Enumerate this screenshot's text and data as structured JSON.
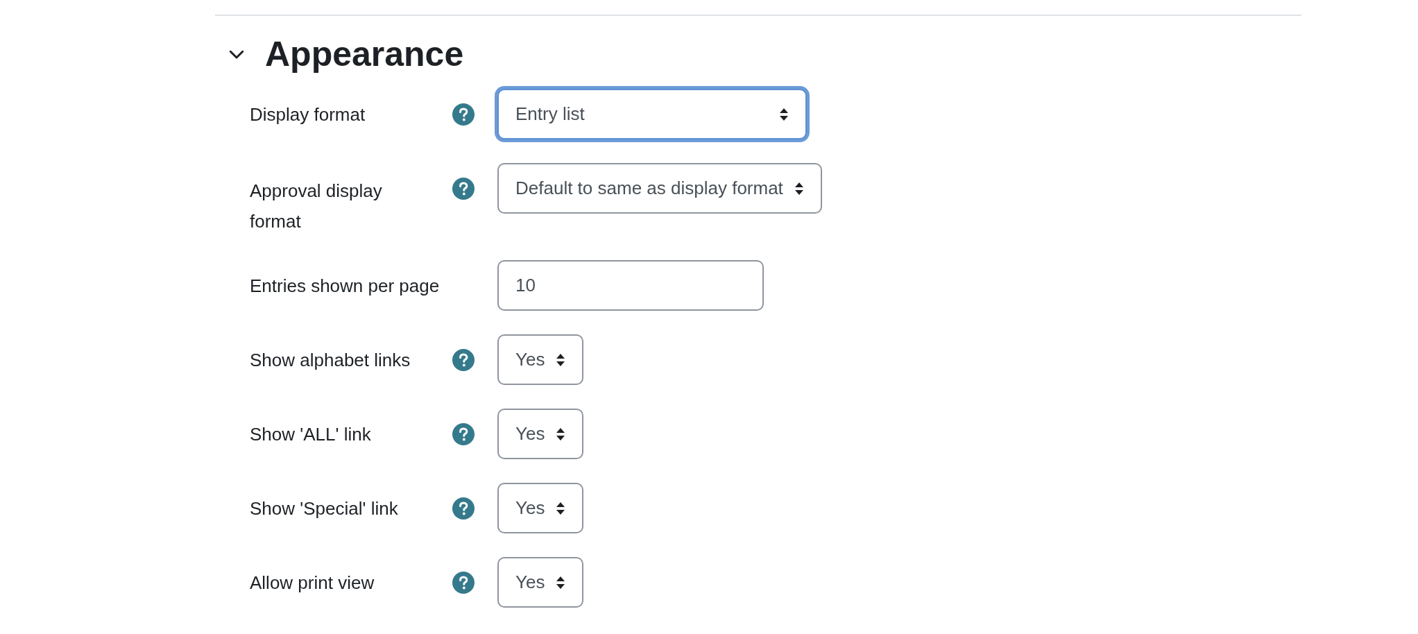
{
  "section": {
    "title": "Appearance",
    "expanded": true
  },
  "fields": [
    {
      "kind": "select",
      "label": "Display format",
      "help": true,
      "value": "Entry list",
      "focused": true
    },
    {
      "kind": "select",
      "label": "Approval display format",
      "help": true,
      "value": "Default to same as display format",
      "focused": false
    },
    {
      "kind": "text",
      "label": "Entries shown per page",
      "help": false,
      "value": "10",
      "focused": false
    },
    {
      "kind": "select",
      "label": "Show alphabet links",
      "help": true,
      "value": "Yes",
      "focused": false
    },
    {
      "kind": "select",
      "label": "Show 'ALL' link",
      "help": true,
      "value": "Yes",
      "focused": false
    },
    {
      "kind": "select",
      "label": "Show 'Special' link",
      "help": true,
      "value": "Yes",
      "focused": false
    },
    {
      "kind": "select",
      "label": "Allow print view",
      "help": true,
      "value": "Yes",
      "focused": false
    }
  ]
}
